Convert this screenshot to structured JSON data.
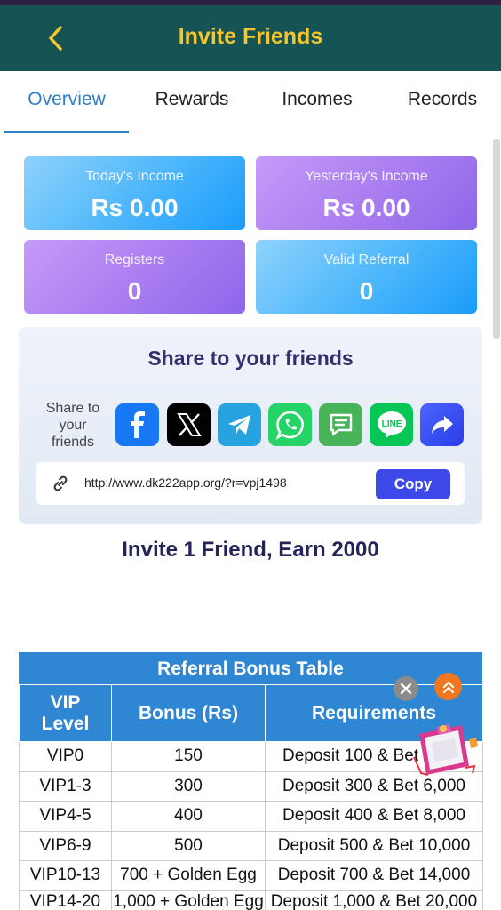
{
  "header": {
    "title": "Invite Friends"
  },
  "tabs": [
    {
      "label": "Overview"
    },
    {
      "label": "Rewards"
    },
    {
      "label": "Incomes"
    },
    {
      "label": "Records"
    }
  ],
  "stats": {
    "today_label": "Today's Income",
    "today_value": "Rs 0.00",
    "yesterday_label": "Yesterday's Income",
    "yesterday_value": "Rs 0.00",
    "registers_label": "Registers",
    "registers_value": "0",
    "valid_label": "Valid Referral",
    "valid_value": "0"
  },
  "share": {
    "title": "Share to your friends",
    "label": "Share to your friends",
    "buttons": [
      "facebook-icon",
      "x-icon",
      "telegram-icon",
      "whatsapp-icon",
      "sms-icon",
      "line-icon",
      "forward-icon"
    ],
    "line_text": "LINE",
    "link": "http://www.dk222app.org/?r=vpj1498",
    "copy_label": "Copy"
  },
  "invite_text": "Invite 1 Friend, Earn 2000",
  "table": {
    "title": "Referral Bonus Table",
    "headers": [
      "VIP Level",
      "Bonus (Rs)",
      "Requirements"
    ],
    "rows": [
      [
        "VIP0",
        "150",
        "Deposit 100 & Bet 2,000"
      ],
      [
        "VIP1-3",
        "300",
        "Deposit 300 & Bet 6,000"
      ],
      [
        "VIP4-5",
        "400",
        "Deposit 400 & Bet 8,000"
      ],
      [
        "VIP6-9",
        "500",
        "Deposit 500 & Bet 10,000"
      ],
      [
        "VIP10-13",
        "700 + Golden Egg",
        "Deposit 700 & Bet 14,000"
      ],
      [
        "VIP14-20",
        "1,000 + Golden Egg",
        "Deposit 1,000 & Bet 20,000"
      ]
    ]
  },
  "colors": {
    "header_bg": "#155354",
    "header_title": "#f7c62b",
    "tab_active": "#2f7ec9",
    "table_header": "#2f87d4",
    "copy_button": "#3d48e8"
  }
}
